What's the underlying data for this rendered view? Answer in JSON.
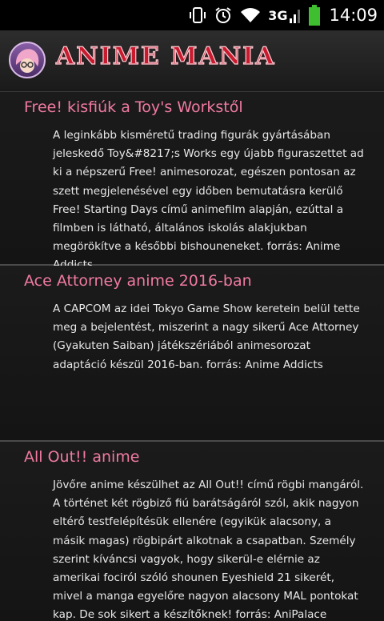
{
  "status_bar": {
    "network": "3G",
    "time": "14:09",
    "icons": [
      "vibrate-icon",
      "alarm-icon",
      "wifi-icon",
      "signal-icon",
      "battery-icon"
    ],
    "battery_color": "#3fbf2f"
  },
  "app_bar": {
    "title": "ANIME MANIA",
    "title_color": "#c91a2e"
  },
  "articles": [
    {
      "title": "Free! kisfiúk a Toy's Workstől",
      "body": "A leginkább kisméretű trading figurák gyártásában jeleskedő Toy&#8217;s Works egy újabb figuraszettet ad ki a népszerű Free! animesorozat, egészen pontosan az szett megjelenésével egy időben bemutatásra kerülő Free! Starting Days című animefilm alapján, ezúttal a filmben is látható, általános iskolás alakjukban megörökítve a későbbi bishouneneket. forrás: Anime Addicts"
    },
    {
      "title": "Ace Attorney anime 2016-ban",
      "body": "A CAPCOM az idei Tokyo Game Show keretein belül tette meg a bejelentést, miszerint a nagy sikerű Ace Attorney (Gyakuten Saiban) játékszériából animesorozat adaptáció készül 2016-ban. forrás: Anime Addicts"
    },
    {
      "title": "All Out!! anime",
      "body": "Jövőre anime készülhet az All Out!! című rögbi mangáról. A történet két rögbiző fiú barátságáról szól, akik nagyon eltérő testfelépítésük ellenére (egyikük alacsony, a másik magas) rögbipárt alkotnak a csapatban. Személy szerint kíváncsi vagyok, hogy sikerül-e elérnie az amerikai fociról szóló shounen Eyeshield 21 sikerét, mivel a manga egyelőre nagyon alacsony MAL pontokat kap. De sok sikert a készítőknek! forrás: AniPalace"
    }
  ],
  "colors": {
    "title_pink": "#f07aa0",
    "body_text": "#e8e8e8",
    "background": "#111111"
  }
}
